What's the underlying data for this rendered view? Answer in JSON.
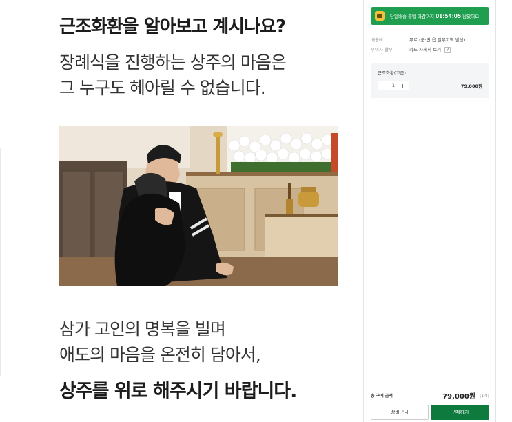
{
  "content": {
    "heading": "근조화환을 알아보고 계시나요?",
    "para1_line1": "장례식을 진행하는 상주의 마음은",
    "para1_line2": "그 누구도 헤아릴 수 없습니다.",
    "para2_line1": "삼가 고인의 명복을 빌며",
    "para2_line2": "애도의 마음을 온전히 담아서,",
    "closing": "상주를 위로 해주시기 바랍니다."
  },
  "panel": {
    "banner_prefix": "당일배송 출발 마감까지",
    "banner_timer": "01:54:05",
    "banner_suffix": "남았어요!",
    "shipping_label": "배송비",
    "shipping_value": "무료 (군·면·읍 일부지역 발생)",
    "interest_label": "무이자 할부",
    "interest_value": "카드 자세히 보기",
    "interest_badge": "?",
    "option_name": "근조화환(고급)",
    "option_minus": "−",
    "option_qty": "1",
    "option_plus": "+",
    "option_price": "79,000원",
    "total_label": "총 구매 금액",
    "total_price": "79,000원",
    "total_count": "(1개)",
    "cart_button": "장바구니",
    "buy_button": "구매하기"
  },
  "colors": {
    "accent_green": "#1f9e4f",
    "buy_green": "#0f7a3e"
  },
  "icons": {
    "banner_icon": "delivery-truck-icon"
  }
}
